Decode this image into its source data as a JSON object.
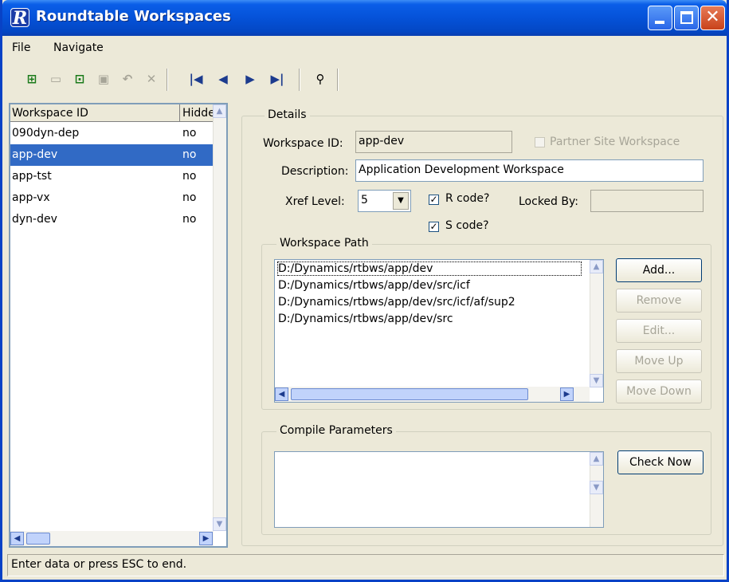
{
  "window": {
    "title": "Roundtable Workspaces",
    "app_icon": "R"
  },
  "menu": {
    "items": [
      {
        "label": "File"
      },
      {
        "label": "Navigate"
      }
    ]
  },
  "toolbar": {
    "icons": [
      "add-record-icon",
      "copy-record-icon",
      "modify-record-icon",
      "save-record-icon",
      "undo-icon",
      "delete-icon",
      "first-record-icon",
      "previous-record-icon",
      "next-record-icon",
      "last-record-icon",
      "binoculars-find-icon"
    ]
  },
  "list": {
    "columns": [
      "Workspace ID",
      "Hidden"
    ],
    "rows": [
      {
        "id": "090dyn-dep",
        "hidden": "no"
      },
      {
        "id": "app-dev",
        "hidden": "no"
      },
      {
        "id": "app-tst",
        "hidden": "no"
      },
      {
        "id": "app-vx",
        "hidden": "no"
      },
      {
        "id": "dyn-dev",
        "hidden": "no"
      }
    ],
    "selected_index": 1
  },
  "details": {
    "group_title": "Details",
    "workspace_id_label": "Workspace ID:",
    "workspace_id_value": "app-dev",
    "partner_site_label": "Partner Site Workspace",
    "description_label": "Description:",
    "description_value": "Application Development Workspace",
    "xref_label": "Xref Level:",
    "xref_value": "5",
    "r_code_label": "R code?",
    "s_code_label": "S code?",
    "locked_by_label": "Locked By:",
    "locked_by_value": ""
  },
  "workspace_path": {
    "group_title": "Workspace Path",
    "paths": [
      "D:/Dynamics/rtbws/app/dev",
      "D:/Dynamics/rtbws/app/dev/src/icf",
      "D:/Dynamics/rtbws/app/dev/src/icf/af/sup2",
      "D:/Dynamics/rtbws/app/dev/src"
    ],
    "buttons": {
      "add": "Add...",
      "remove": "Remove",
      "edit": "Edit...",
      "move_up": "Move Up",
      "move_down": "Move Down"
    }
  },
  "compile": {
    "group_title": "Compile Parameters",
    "check_now": "Check Now"
  },
  "status": {
    "text": "Enter data or press ESC to end."
  },
  "colors": {
    "title_blue": "#0552d8",
    "selection": "#316ac5",
    "window_bg": "#ece9d8"
  }
}
